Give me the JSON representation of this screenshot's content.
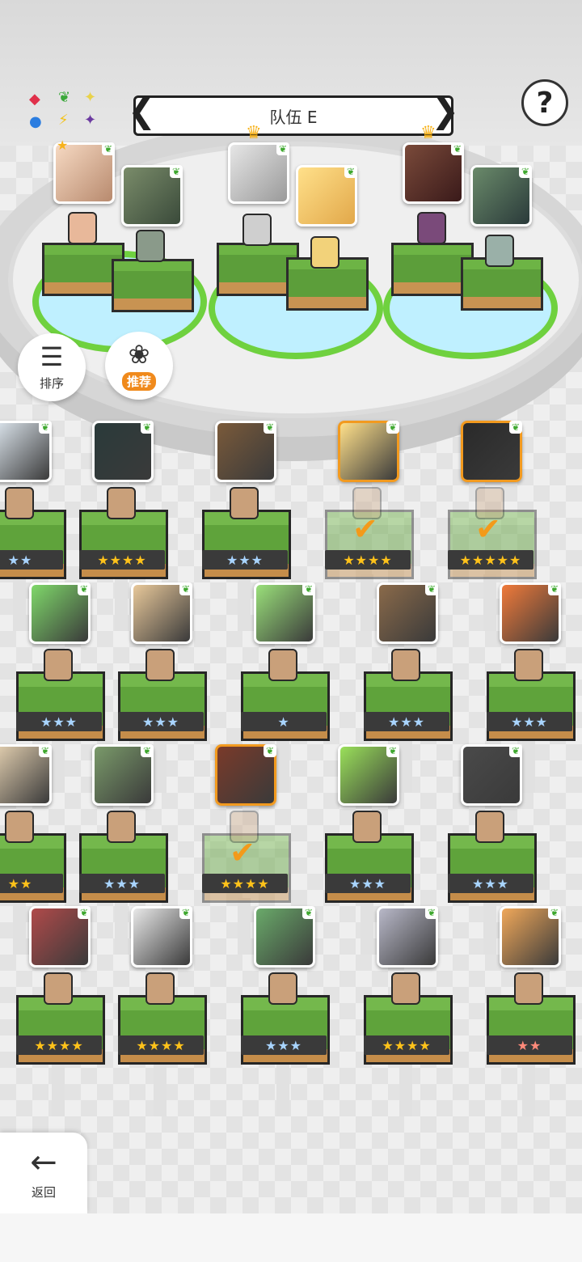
{
  "header": {
    "team_name": "队伍 E",
    "prev_icon": "chevron-left-icon",
    "next_icon": "chevron-right-icon",
    "help_label": "?"
  },
  "elements_legend": {
    "fire": "◆",
    "grass": "❦",
    "light": "✦",
    "water": "●",
    "thunder": "⚡",
    "dark": "✦"
  },
  "side_buttons": {
    "sort_label": "排序",
    "recommend_label": "推荐"
  },
  "back": {
    "label": "返回"
  },
  "roster_rows": [
    [
      {
        "stars": "★★",
        "tone": "silver",
        "selected": false
      },
      {
        "stars": "★★★★",
        "tone": "gold",
        "selected": false
      },
      {
        "stars": "★★★",
        "tone": "silver",
        "selected": false
      },
      {
        "stars": "★★★★",
        "tone": "gold",
        "selected": true
      },
      {
        "stars": "★★★★★",
        "tone": "gold",
        "selected": true
      }
    ],
    [
      {
        "stars": "★★★",
        "tone": "silver",
        "selected": false
      },
      {
        "stars": "★★★",
        "tone": "silver",
        "selected": false
      },
      {
        "stars": "★",
        "tone": "silver",
        "selected": false
      },
      {
        "stars": "★★★",
        "tone": "silver",
        "selected": false
      },
      {
        "stars": "★★★",
        "tone": "silver",
        "selected": false
      }
    ],
    [
      {
        "stars": "★★",
        "tone": "gold",
        "selected": false
      },
      {
        "stars": "★★★",
        "tone": "silver",
        "selected": false
      },
      {
        "stars": "★★★★",
        "tone": "gold",
        "selected": true
      },
      {
        "stars": "★★★",
        "tone": "silver",
        "selected": false
      },
      {
        "stars": "★★★",
        "tone": "silver",
        "selected": false
      }
    ],
    [
      {
        "stars": "★★★★",
        "tone": "gold",
        "selected": false
      },
      {
        "stars": "★★★★",
        "tone": "gold",
        "selected": false
      },
      {
        "stars": "★★★",
        "tone": "silver",
        "selected": false
      },
      {
        "stars": "★★★★",
        "tone": "gold",
        "selected": false
      },
      {
        "stars": "★★",
        "tone": "red",
        "selected": false
      }
    ]
  ]
}
